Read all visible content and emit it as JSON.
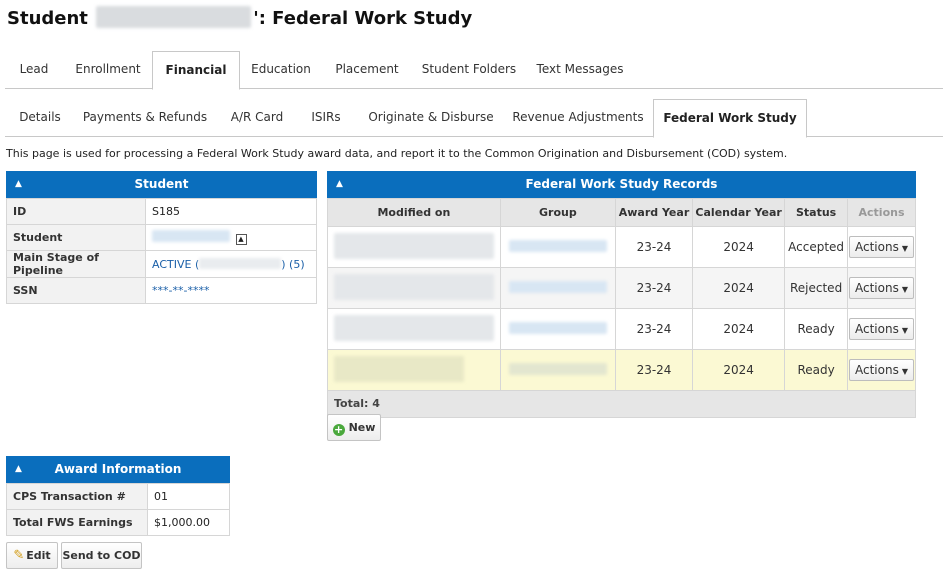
{
  "page": {
    "title_prefix": "Student",
    "title_suffix": "': Federal Work Study",
    "intro": "This page is used for processing a Federal Work Study award data, and report it to the Common Origination and Disbursement (COD) system."
  },
  "main_tabs": [
    "Lead",
    "Enrollment",
    "Financial",
    "Education",
    "Placement",
    "Student Folders",
    "Text Messages"
  ],
  "sub_tabs": [
    "Details",
    "Payments & Refunds",
    "A/R Card",
    "ISIRs",
    "Originate & Disburse",
    "Revenue Adjustments",
    "Federal Work Study"
  ],
  "student_panel": {
    "title": "Student",
    "rows": [
      {
        "label": "ID",
        "value": "S185"
      },
      {
        "label": "Student",
        "value": ""
      },
      {
        "label": "Main Stage of Pipeline",
        "value_prefix": "ACTIVE (",
        "value_suffix": ") (5)"
      },
      {
        "label": "SSN",
        "value": "***-**-****"
      }
    ]
  },
  "fws_panel": {
    "title": "Federal Work Study Records",
    "columns": [
      "Modified on",
      "Group",
      "Award Year",
      "Calendar Year",
      "Status",
      "Actions"
    ],
    "rows": [
      {
        "award_year": "23-24",
        "calendar_year": "2024",
        "status": "Accepted",
        "action": "Actions"
      },
      {
        "award_year": "23-24",
        "calendar_year": "2024",
        "status": "Rejected",
        "action": "Actions"
      },
      {
        "award_year": "23-24",
        "calendar_year": "2024",
        "status": "Ready",
        "action": "Actions"
      },
      {
        "award_year": "23-24",
        "calendar_year": "2024",
        "status": "Ready",
        "action": "Actions"
      }
    ],
    "total": "Total: 4",
    "new_label": "New"
  },
  "award_panel": {
    "title": "Award Information",
    "rows": [
      {
        "label": "CPS Transaction #",
        "value": "01"
      },
      {
        "label": "Total FWS Earnings",
        "value": "$1,000.00"
      }
    ]
  },
  "buttons": {
    "edit": "Edit",
    "send_to_cod": "Send to COD"
  },
  "colors": {
    "header_blue": "#0a6ebd",
    "highlight_row": "#fbf9d3",
    "link": "#1a5fa8"
  }
}
